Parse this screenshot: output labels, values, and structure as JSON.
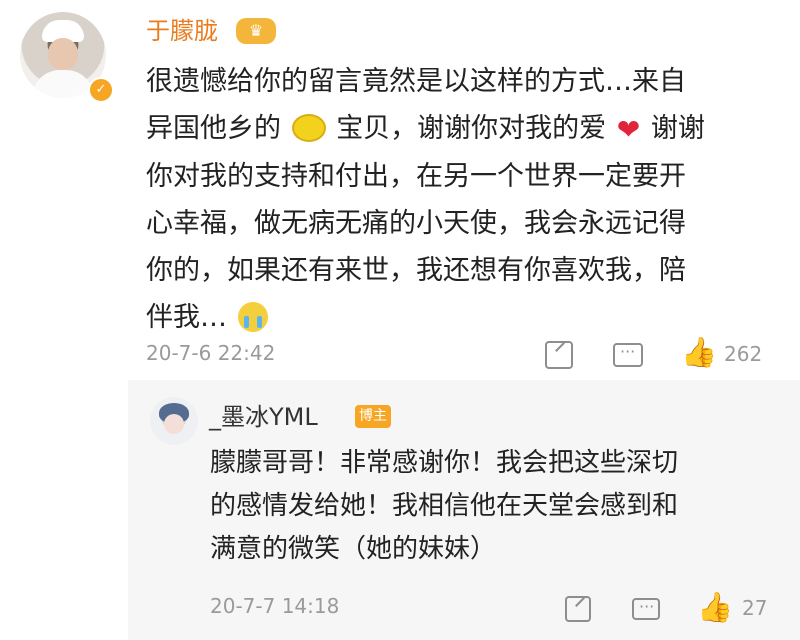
{
  "main_comment": {
    "author": "于朦胧",
    "crown_badge": "♛",
    "verified_badge": "✓",
    "text_lines": [
      "很遗憾给你的留言竟然是以这样的方式…来自",
      "异国他乡的",
      "宝贝，谢谢你对我的爱",
      "谢谢",
      "你对我的支持和付出，在另一个世界一定要开",
      "心幸福，做无病无痛的小天使，我会永远记得",
      "你的，如果还有来世，我还想有你喜欢我，陪",
      "伴我…"
    ],
    "emoji_names": [
      "lemon-emoji",
      "heart-emoji",
      "crying-emoji"
    ],
    "timestamp": "20-7-6 22:42",
    "like_count": "262"
  },
  "reply": {
    "author": "_墨冰YML",
    "badge": "博主",
    "text_lines": [
      "朦朦哥哥！非常感谢你！我会把这些深切",
      "的感情发给她！我相信他在天堂会感到和",
      "满意的微笑（她的妹妹）"
    ],
    "timestamp": "20-7-7 14:18",
    "like_count": "27"
  },
  "icons": {
    "share": "share-icon",
    "comment": "comment-icon",
    "like": "thumbs-up-icon",
    "heart": "❤",
    "like_glyph": "👍"
  },
  "colors": {
    "author": "#ea7c1f",
    "badge": "#f6a623",
    "meta": "#9a9a9a",
    "reply_bg": "#f6f6f6"
  }
}
